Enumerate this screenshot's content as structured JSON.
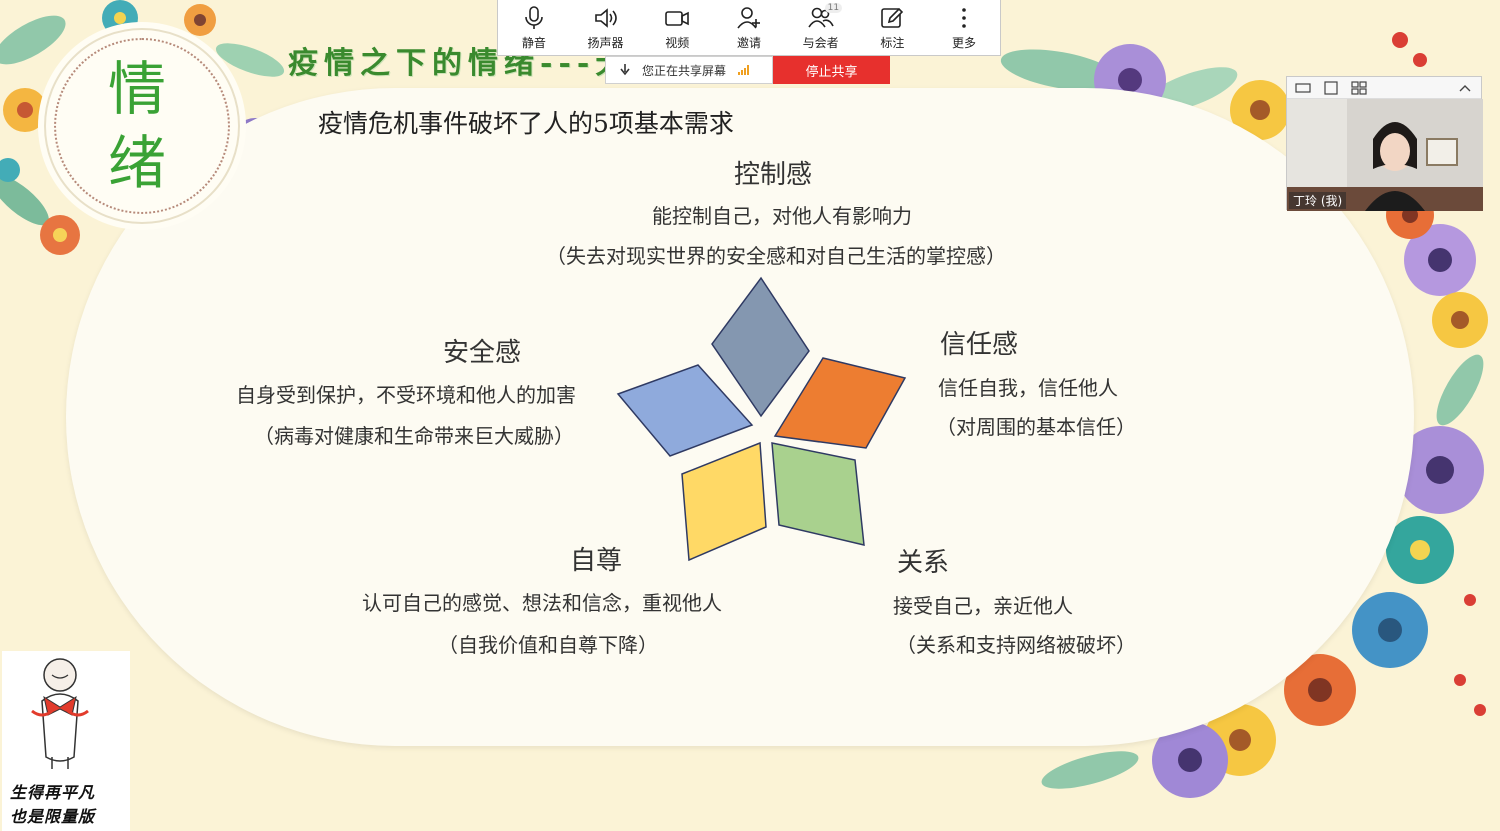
{
  "toolbar": {
    "items": [
      {
        "label": "静音",
        "icon": "microphone-icon"
      },
      {
        "label": "扬声器",
        "icon": "speaker-icon"
      },
      {
        "label": "视频",
        "icon": "video-camera-icon"
      },
      {
        "label": "邀请",
        "icon": "add-user-icon"
      },
      {
        "label": "与会者",
        "icon": "participants-icon",
        "count": "11"
      },
      {
        "label": "标注",
        "icon": "annotate-icon"
      },
      {
        "label": "更多",
        "icon": "more-icon"
      }
    ],
    "share_status": "您正在共享屏幕",
    "stop_share": "停止共享"
  },
  "video": {
    "name": "丁玲 (我)"
  },
  "slide": {
    "title": "疫情之下的情绪---无助感增加",
    "emblem": [
      "情",
      "绪"
    ],
    "heading": "疫情危机事件破坏了人的5项基本需求",
    "needs": {
      "control": {
        "title": "控制感",
        "line1": "能控制自己，对他人有影响力",
        "line2": "（失去对现实世界的安全感和对自己生活的掌控感）"
      },
      "security": {
        "title": "安全感",
        "line1": "自身受到保护，不受环境和他人的加害",
        "line2": "（病毒对健康和生命带来巨大威胁）"
      },
      "trust": {
        "title": "信任感",
        "line1": "信任自我，信任他人",
        "line2": "（对周围的基本信任）"
      },
      "esteem": {
        "title": "自尊",
        "line1": "认可自己的感觉、想法和信念，重视他人",
        "line2": "（自我价值和自尊下降）"
      },
      "relation": {
        "title": "关系",
        "line1": "接受自己，亲近他人",
        "line2": "（关系和支持网络被破坏）"
      }
    },
    "star_colors": {
      "top": "#8497b0",
      "right": "#ed7d31",
      "left": "#8faadc",
      "bottom_left": "#ffd966",
      "bottom_right": "#a9d18e"
    }
  },
  "logo": {
    "line1": "生得再平凡",
    "line2": "也是限量版"
  }
}
